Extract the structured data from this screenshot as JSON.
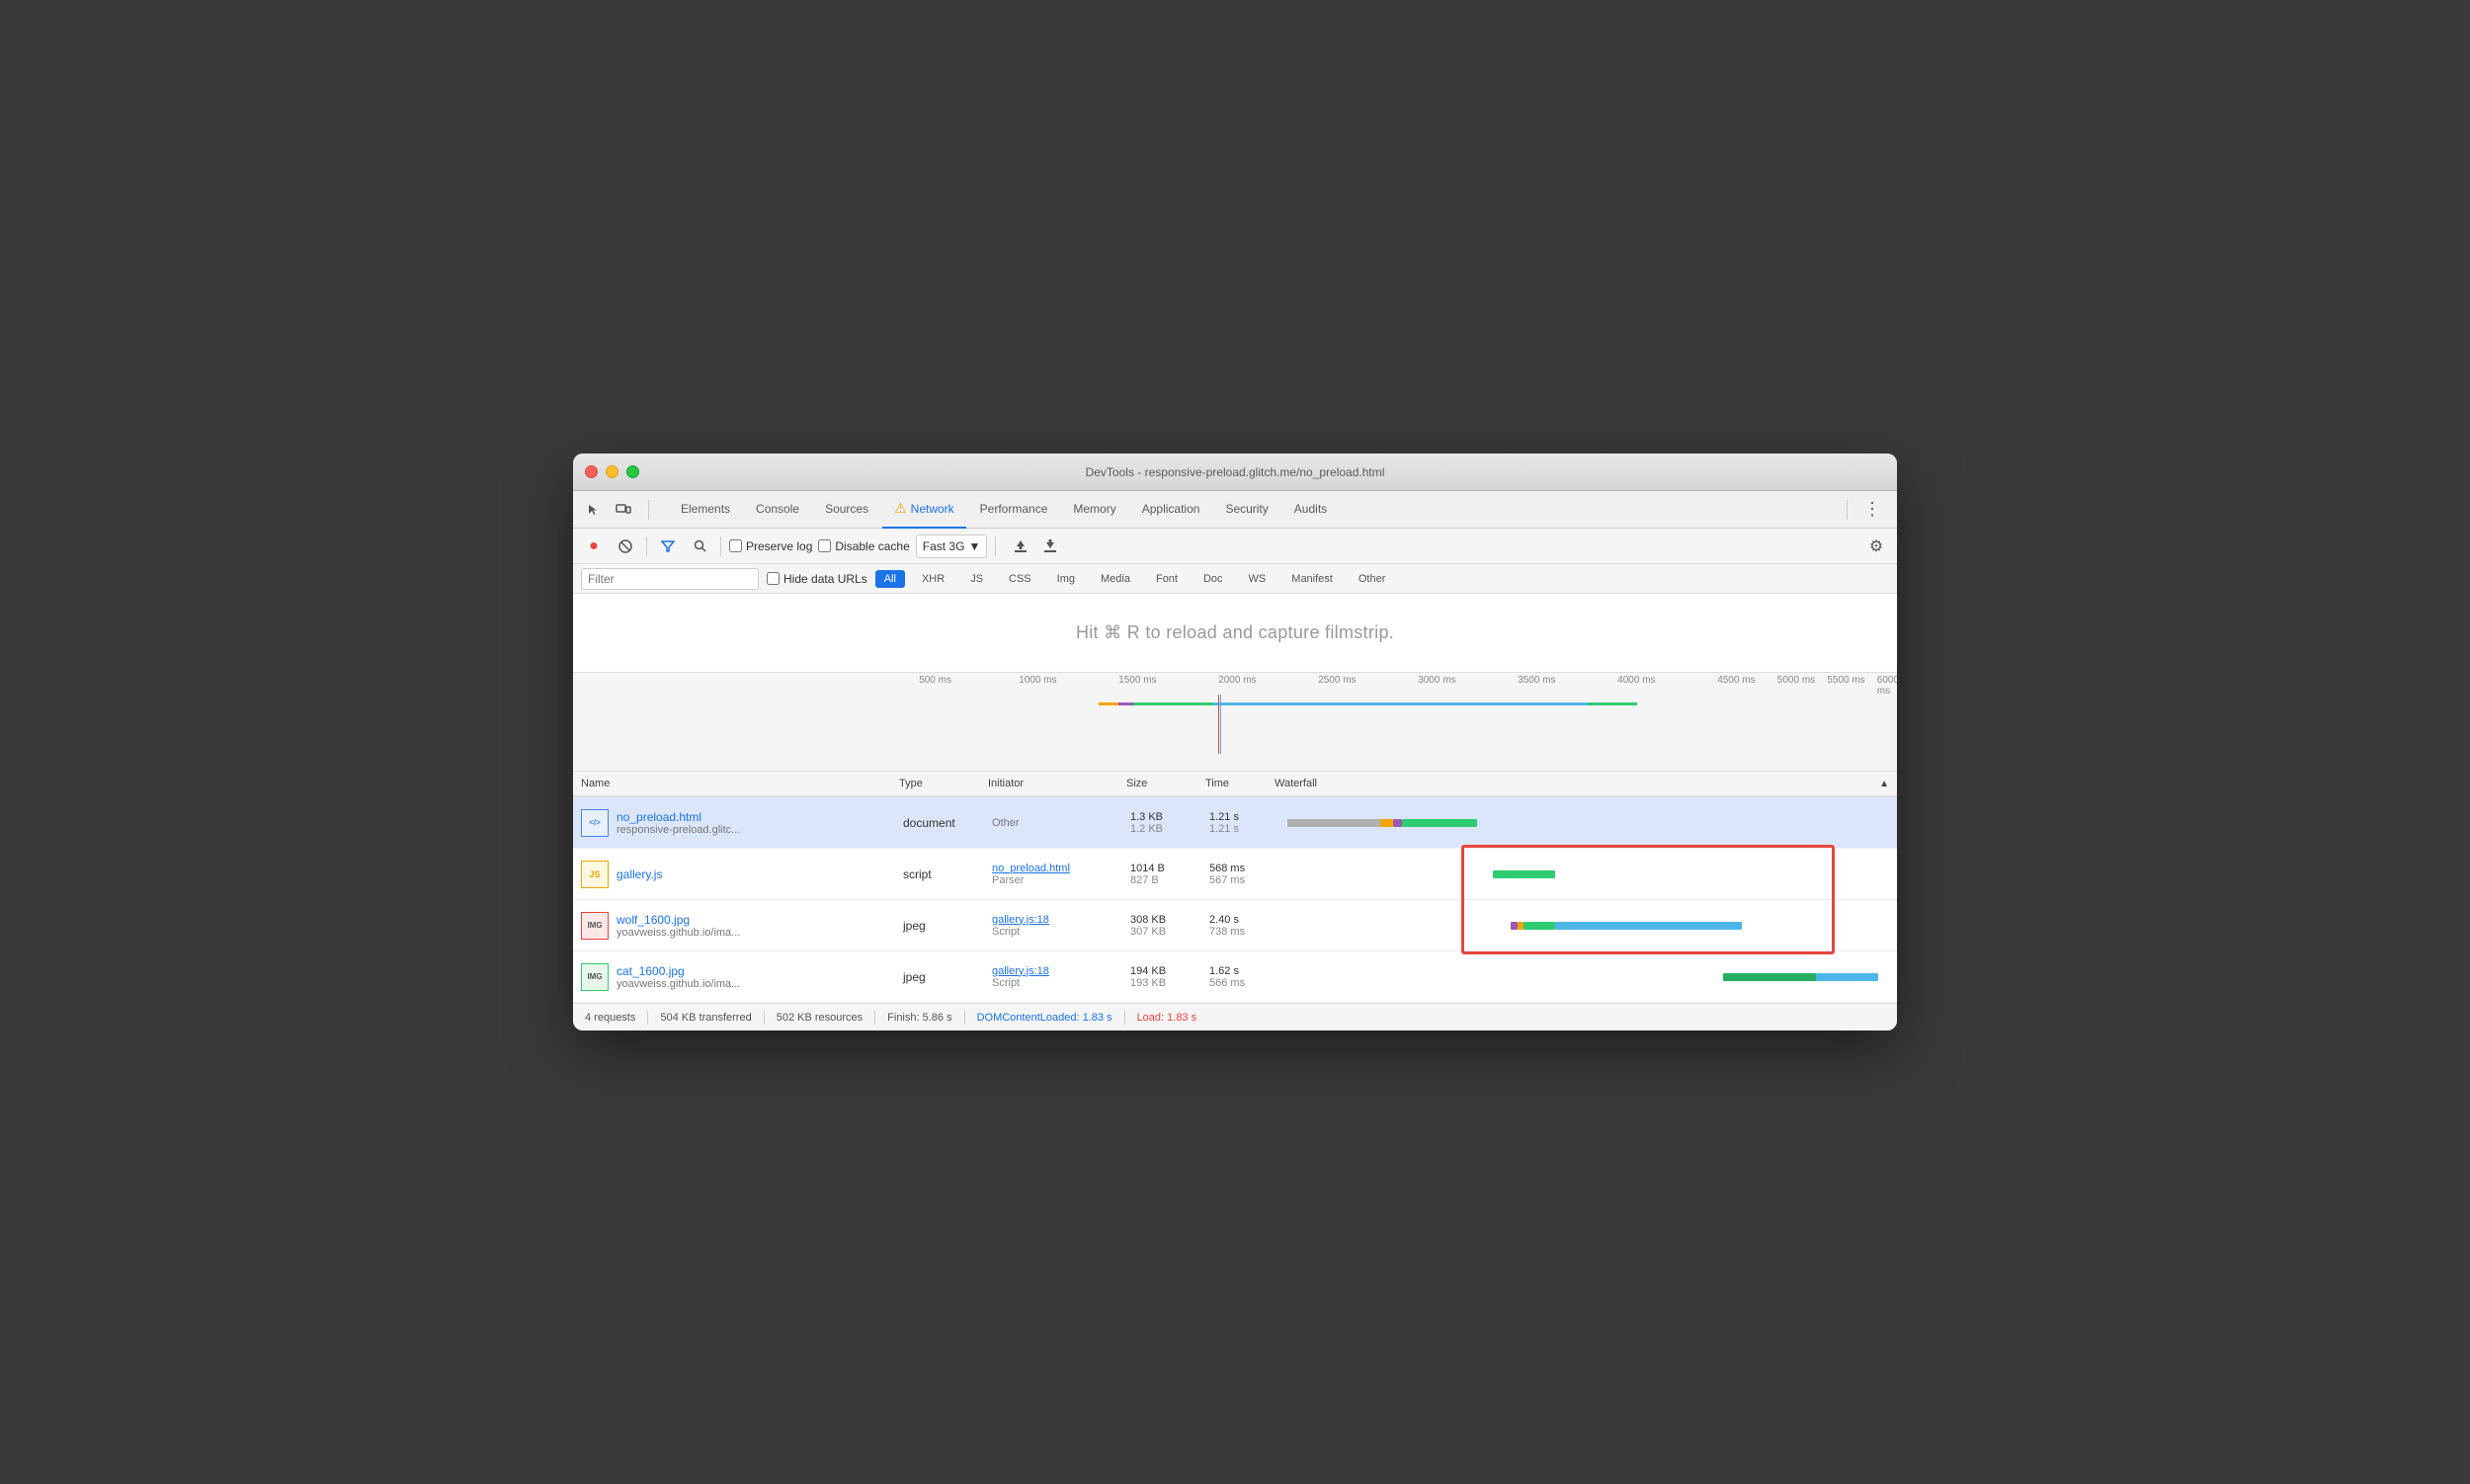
{
  "window": {
    "title": "DevTools - responsive-preload.glitch.me/no_preload.html"
  },
  "tabs": [
    {
      "id": "elements",
      "label": "Elements",
      "active": false
    },
    {
      "id": "console",
      "label": "Console",
      "active": false
    },
    {
      "id": "sources",
      "label": "Sources",
      "active": false
    },
    {
      "id": "network",
      "label": "Network",
      "active": true,
      "warning": true
    },
    {
      "id": "performance",
      "label": "Performance",
      "active": false
    },
    {
      "id": "memory",
      "label": "Memory",
      "active": false
    },
    {
      "id": "application",
      "label": "Application",
      "active": false
    },
    {
      "id": "security",
      "label": "Security",
      "active": false
    },
    {
      "id": "audits",
      "label": "Audits",
      "active": false
    }
  ],
  "toolbar": {
    "preserve_log": "Preserve log",
    "disable_cache": "Disable cache",
    "throttle": "Fast 3G"
  },
  "filter": {
    "placeholder": "Filter",
    "hide_data_urls": "Hide data URLs",
    "buttons": [
      "All",
      "XHR",
      "JS",
      "CSS",
      "Img",
      "Media",
      "Font",
      "Doc",
      "WS",
      "Manifest",
      "Other"
    ]
  },
  "filmstrip": {
    "message": "Hit ⌘ R to reload and capture filmstrip."
  },
  "ruler": {
    "marks": [
      "500 ms",
      "1000 ms",
      "1500 ms",
      "2000 ms",
      "2500 ms",
      "3000 ms",
      "3500 ms",
      "4000 ms",
      "4500 ms",
      "5000 ms",
      "5500 ms",
      "6000 ms"
    ]
  },
  "table": {
    "headers": [
      "Name",
      "Type",
      "Initiator",
      "Size",
      "Time",
      "Waterfall"
    ],
    "rows": [
      {
        "id": "row1",
        "icon": "HTML",
        "filename": "no_preload.html",
        "domain": "responsive-preload.glitc...",
        "type": "document",
        "initiator": "Other",
        "initiator_link": null,
        "size1": "1.3 KB",
        "size2": "1.2 KB",
        "time1": "1.21 s",
        "time2": "1.21 s",
        "selected": true
      },
      {
        "id": "row2",
        "icon": "JS",
        "filename": "gallery.js",
        "domain": "",
        "type": "script",
        "initiator": "no_preload.html",
        "initiator_sub": "Parser",
        "initiator_link": true,
        "size1": "1014 B",
        "size2": "827 B",
        "time1": "568 ms",
        "time2": "567 ms",
        "selected": false
      },
      {
        "id": "row3",
        "icon": "IMG",
        "filename": "wolf_1600.jpg",
        "domain": "yoavweiss.github.io/ima...",
        "type": "jpeg",
        "initiator": "gallery.js:18",
        "initiator_sub": "Script",
        "initiator_link": true,
        "size1": "308 KB",
        "size2": "307 KB",
        "time1": "2.40 s",
        "time2": "738 ms",
        "selected": false
      },
      {
        "id": "row4",
        "icon": "IMG",
        "filename": "cat_1600.jpg",
        "domain": "yoavweiss.github.io/ima...",
        "type": "jpeg",
        "initiator": "gallery.js:18",
        "initiator_sub": "Script",
        "initiator_link": true,
        "size1": "194 KB",
        "size2": "193 KB",
        "time1": "1.62 s",
        "time2": "566 ms",
        "selected": false
      }
    ]
  },
  "statusbar": {
    "requests": "4 requests",
    "transferred": "504 KB transferred",
    "resources": "502 KB resources",
    "finish": "Finish: 5.86 s",
    "dom_loaded": "DOMContentLoaded: 1.83 s",
    "load": "Load: 1.83 s"
  },
  "colors": {
    "accent_blue": "#1a73e8",
    "record_red": "#e8453c",
    "active_tab": "#1a73e8",
    "wf_gray": "#b0b0b0",
    "wf_orange": "#f0a500",
    "wf_purple": "#9b59b6",
    "wf_green": "#2ecc71",
    "wf_blue": "#4db6e8",
    "wf_dark_green": "#27ae60"
  }
}
